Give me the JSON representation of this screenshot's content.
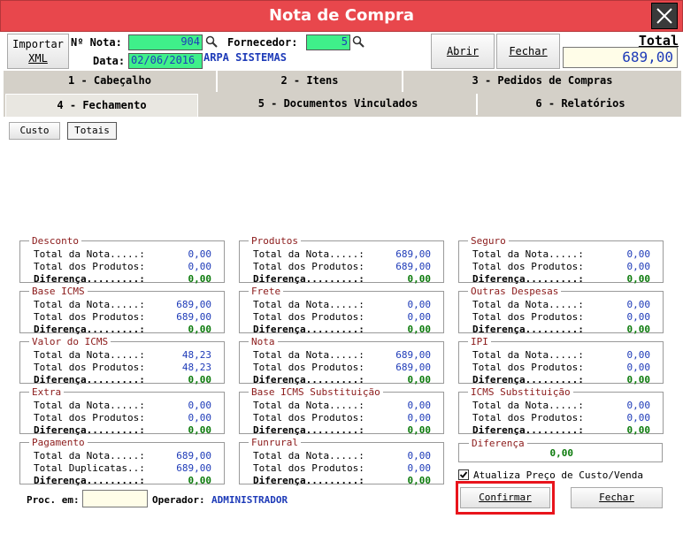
{
  "window": {
    "title": "Nota de Compra"
  },
  "header": {
    "importar_label_1": "Importar",
    "importar_label_2": "XML",
    "nota_label": "Nº Nota:",
    "nota_value": "904",
    "data_label": "Data:",
    "data_value": "02/06/2016",
    "fornecedor_label": "Fornecedor:",
    "fornecedor_value": "5",
    "fornecedor_name": "ARPA SISTEMAS",
    "abrir_label": "Abrir",
    "fechar_label": "Fechar",
    "total_label": "Total",
    "total_value": "689,00"
  },
  "tabs_row1": [
    {
      "label": "1 - Cabeçalho"
    },
    {
      "label": "2 - Itens"
    },
    {
      "label": "3 - Pedidos de Compras"
    }
  ],
  "tabs_row2": [
    {
      "label": "4 - Fechamento"
    },
    {
      "label": "5 - Documentos Vinculados"
    },
    {
      "label": "6 - Relatórios"
    }
  ],
  "subtabs": [
    {
      "label": "Custo"
    },
    {
      "label": "Totais"
    }
  ],
  "labels": {
    "total_nota": "Total da Nota.....:",
    "total_produtos": "Total dos Produtos:",
    "diferenca": "Diferença.........:",
    "total_duplicatas": "Total Duplicatas..:"
  },
  "groups": [
    {
      "title": "Desconto",
      "v1": "0,00",
      "v2": "0,00",
      "d": "0,00"
    },
    {
      "title": "Base ICMS",
      "v1": "689,00",
      "v2": "689,00",
      "d": "0,00"
    },
    {
      "title": "Valor do ICMS",
      "v1": "48,23",
      "v2": "48,23",
      "d": "0,00"
    },
    {
      "title": "Extra",
      "v1": "0,00",
      "v2": "0,00",
      "d": "0,00"
    },
    {
      "title": "Pagamento",
      "v1": "689,00",
      "v2": "689,00",
      "d": "0,00"
    },
    {
      "title": "Produtos",
      "v1": "689,00",
      "v2": "689,00",
      "d": "0,00"
    },
    {
      "title": "Frete",
      "v1": "0,00",
      "v2": "0,00",
      "d": "0,00"
    },
    {
      "title": "Nota",
      "v1": "689,00",
      "v2": "689,00",
      "d": "0,00"
    },
    {
      "title": "Base ICMS Substituição",
      "v1": "0,00",
      "v2": "0,00",
      "d": "0,00"
    },
    {
      "title": "Funrural",
      "v1": "0,00",
      "v2": "0,00",
      "d": "0,00"
    },
    {
      "title": "Seguro",
      "v1": "0,00",
      "v2": "0,00",
      "d": "0,00"
    },
    {
      "title": "Outras Despesas",
      "v1": "0,00",
      "v2": "0,00",
      "d": "0,00"
    },
    {
      "title": "IPI",
      "v1": "0,00",
      "v2": "0,00",
      "d": "0,00"
    },
    {
      "title": "ICMS Substituição",
      "v1": "0,00",
      "v2": "0,00",
      "d": "0,00"
    }
  ],
  "diferenca_box": {
    "title": "Diferença",
    "value": "0,00"
  },
  "footer": {
    "proc_label": "Proc. em:",
    "proc_value": "",
    "operador_label": "Operador:",
    "operador_value": "ADMINISTRADOR",
    "atualiza_label": "Atualiza Preço de Custo/Venda",
    "atualiza_checked": true,
    "confirmar_label": "Confirmar",
    "fechar_label": "Fechar"
  }
}
